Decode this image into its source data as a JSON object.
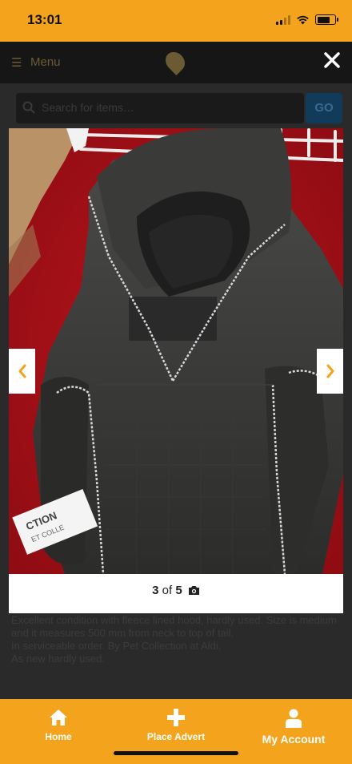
{
  "status_bar": {
    "time": "13:01",
    "battery_level": 0.75
  },
  "background_page": {
    "menu_label": "Menu",
    "search_placeholder": "Search for items…",
    "go_label": "GO",
    "description": [
      "Excellent condition with fleece lined hood, hardly used. Size is medium and it measures 500 mm from neck to top of tail.",
      "In serviceable order. By Pet Collection at Aldi.",
      "As new hardly used."
    ]
  },
  "lightbox": {
    "close_icon": "close-icon",
    "current_index": "3",
    "of_text": "of",
    "total": "5",
    "camera_icon": "camera-icon",
    "prev_icon": "chevron-left-icon",
    "next_icon": "chevron-right-icon",
    "photo_subject": "dark grey dog coat with fleece-lined hood on red rug",
    "tag_text": [
      "CTION",
      "ET COLLE"
    ]
  },
  "bottom_nav": {
    "items": [
      {
        "label": "Home",
        "icon": "home-icon"
      },
      {
        "label": "Place Advert",
        "icon": "plus-icon"
      },
      {
        "label": "My Account",
        "icon": "user-icon"
      }
    ]
  },
  "colors": {
    "brand_orange": "#f4a41c",
    "go_button": "#123a59",
    "rug_red": "#c01820"
  }
}
